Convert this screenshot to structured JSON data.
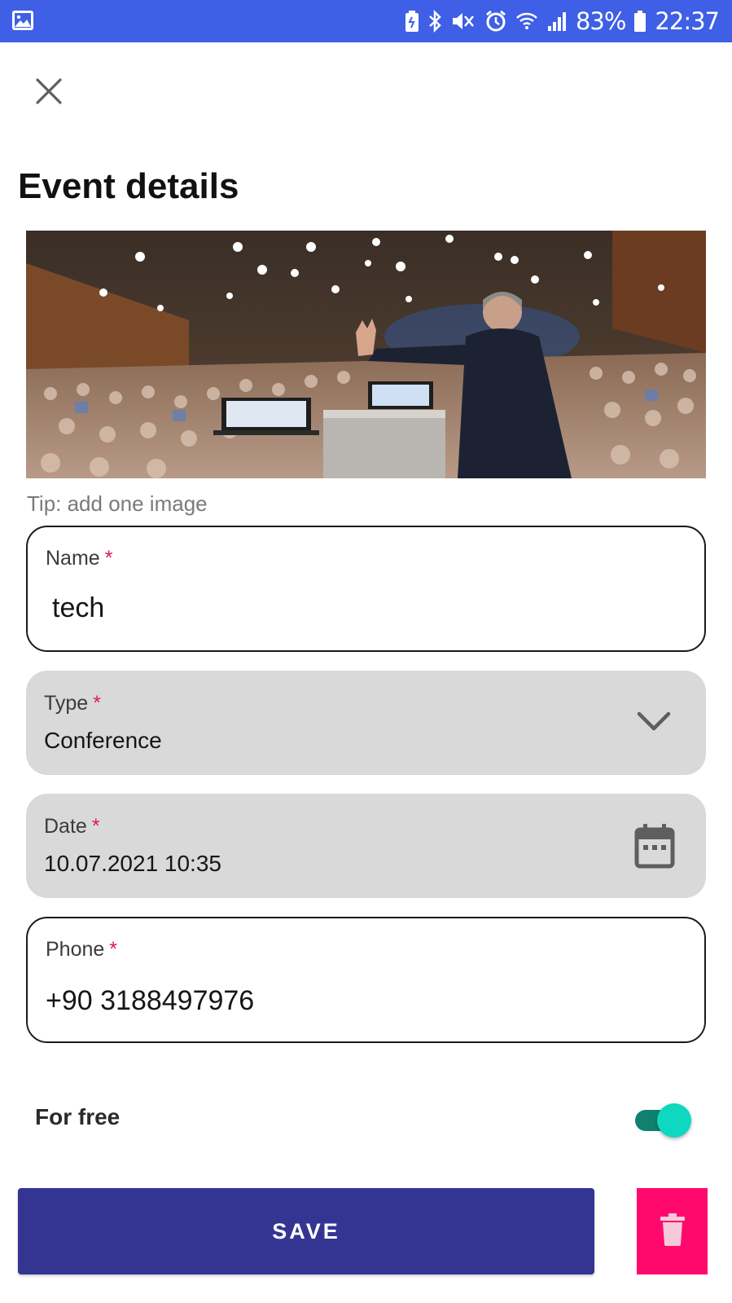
{
  "status_bar": {
    "battery": "83%",
    "time": "22:37",
    "bg_color": "#3f5fe6",
    "icons": [
      "gallery-icon",
      "battery-saver-icon",
      "bluetooth-icon",
      "vibrate-icon",
      "alarm-icon",
      "wifi-icon",
      "signal-icon",
      "battery-icon"
    ]
  },
  "page": {
    "title": "Event details",
    "tip": "Tip: add one image"
  },
  "form": {
    "name": {
      "label": "Name",
      "required_mark": "*",
      "value": "tech"
    },
    "type": {
      "label": "Type",
      "required_mark": "*",
      "value": "Conference"
    },
    "date": {
      "label": "Date",
      "required_mark": "*",
      "value": "10.07.2021 10:35"
    },
    "phone": {
      "label": "Phone",
      "required_mark": "*",
      "value": "+90 3188497976"
    },
    "for_free": {
      "label": "For free",
      "checked": true
    }
  },
  "actions": {
    "save_label": "SAVE",
    "save_color": "#343593",
    "delete_color": "#ff0a6c"
  },
  "colors": {
    "required": "#e0156c",
    "toggle_on": "#0fd8c0"
  }
}
